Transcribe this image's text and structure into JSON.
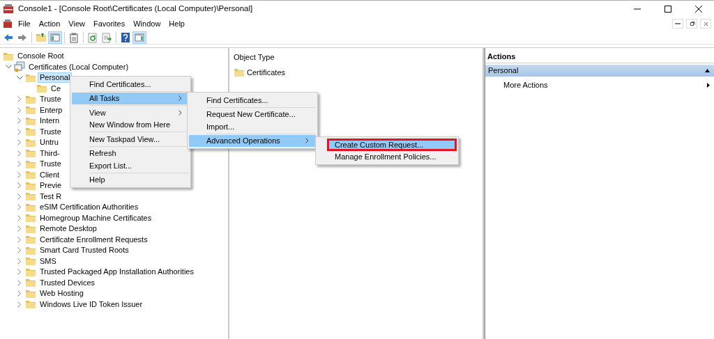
{
  "window": {
    "title": "Console1 - [Console Root\\Certificates (Local Computer)\\Personal]"
  },
  "menu_bar": [
    "File",
    "Action",
    "View",
    "Favorites",
    "Window",
    "Help"
  ],
  "toolbar": [
    {
      "kind": "back",
      "on": false
    },
    {
      "kind": "forward",
      "on": false
    },
    {
      "kind": "sep"
    },
    {
      "kind": "folder-up",
      "on": false
    },
    {
      "kind": "tree-pane",
      "on": true
    },
    {
      "kind": "sep"
    },
    {
      "kind": "clipboard",
      "on": false
    },
    {
      "kind": "sep"
    },
    {
      "kind": "refresh",
      "on": false
    },
    {
      "kind": "export",
      "on": false
    },
    {
      "kind": "sep"
    },
    {
      "kind": "help",
      "on": false
    },
    {
      "kind": "action-pane",
      "on": true
    }
  ],
  "tree": [
    {
      "label": "Console Root",
      "kind": "folder",
      "selected": false,
      "children": [
        {
          "label": "Certificates (Local Computer)",
          "kind": "store",
          "expanded": true,
          "selected": false,
          "children": [
            {
              "label": "Personal",
              "kind": "folder",
              "expanded": true,
              "selected": true,
              "children": [
                {
                  "label": "Ce",
                  "kind": "folder",
                  "selected": false
                }
              ]
            },
            {
              "label": "Truste",
              "kind": "folder",
              "expanded": false,
              "selected": false
            },
            {
              "label": "Enterp",
              "kind": "folder",
              "expanded": false,
              "selected": false
            },
            {
              "label": "Intern",
              "kind": "folder",
              "expanded": false,
              "selected": false
            },
            {
              "label": "Truste",
              "kind": "folder",
              "expanded": false,
              "selected": false
            },
            {
              "label": "Untru",
              "kind": "folder",
              "expanded": false,
              "selected": false
            },
            {
              "label": "Third-",
              "kind": "folder",
              "expanded": false,
              "selected": false
            },
            {
              "label": "Truste",
              "kind": "folder",
              "expanded": false,
              "selected": false
            },
            {
              "label": "Client",
              "kind": "folder",
              "expanded": false,
              "selected": false
            },
            {
              "label": "Previe",
              "kind": "folder",
              "expanded": false,
              "selected": false
            },
            {
              "label": "Test R",
              "kind": "folder",
              "expanded": false,
              "selected": false
            },
            {
              "label": "eSIM Certification Authorities",
              "kind": "folder",
              "expanded": false,
              "selected": false
            },
            {
              "label": "Homegroup Machine Certificates",
              "kind": "folder",
              "expanded": false,
              "selected": false
            },
            {
              "label": "Remote Desktop",
              "kind": "folder",
              "expanded": false,
              "selected": false
            },
            {
              "label": "Certificate Enrollment Requests",
              "kind": "folder",
              "expanded": false,
              "selected": false
            },
            {
              "label": "Smart Card Trusted Roots",
              "kind": "folder",
              "expanded": false,
              "selected": false
            },
            {
              "label": "SMS",
              "kind": "folder",
              "expanded": false,
              "selected": false
            },
            {
              "label": "Trusted Packaged App Installation Authorities",
              "kind": "folder",
              "expanded": false,
              "selected": false
            },
            {
              "label": "Trusted Devices",
              "kind": "folder",
              "expanded": false,
              "selected": false
            },
            {
              "label": "Web Hosting",
              "kind": "folder",
              "expanded": false,
              "selected": false
            },
            {
              "label": "Windows Live ID Token Issuer",
              "kind": "folder",
              "expanded": false,
              "selected": false
            }
          ]
        }
      ]
    }
  ],
  "list": {
    "columns": [
      "Object Type"
    ],
    "rows": [
      "Certificates"
    ]
  },
  "actions": {
    "title": "Actions",
    "section": "Personal",
    "items": [
      "More Actions"
    ]
  },
  "context_menus": [
    {
      "items": [
        {
          "kind": "item",
          "label": "Find Certificates...",
          "submenu": false,
          "selected": false
        },
        {
          "kind": "separator"
        },
        {
          "kind": "item",
          "label": "All Tasks",
          "submenu": true,
          "selected": true
        },
        {
          "kind": "separator"
        },
        {
          "kind": "item",
          "label": "View",
          "submenu": true,
          "selected": false
        },
        {
          "kind": "item",
          "label": "New Window from Here",
          "submenu": false,
          "selected": false
        },
        {
          "kind": "separator"
        },
        {
          "kind": "item",
          "label": "New Taskpad View...",
          "submenu": false,
          "selected": false
        },
        {
          "kind": "separator"
        },
        {
          "kind": "item",
          "label": "Refresh",
          "submenu": false,
          "selected": false
        },
        {
          "kind": "item",
          "label": "Export List...",
          "submenu": false,
          "selected": false
        },
        {
          "kind": "separator"
        },
        {
          "kind": "item",
          "label": "Help",
          "submenu": false,
          "selected": false
        }
      ]
    },
    {
      "items": [
        {
          "kind": "item",
          "label": "Find Certificates...",
          "submenu": false,
          "selected": false
        },
        {
          "kind": "separator"
        },
        {
          "kind": "item",
          "label": "Request New Certificate...",
          "submenu": false,
          "selected": false
        },
        {
          "kind": "item",
          "label": "Import...",
          "submenu": false,
          "selected": false
        },
        {
          "kind": "separator"
        },
        {
          "kind": "item",
          "label": "Advanced Operations",
          "submenu": true,
          "selected": true
        }
      ]
    },
    {
      "items": [
        {
          "kind": "item",
          "label": "Create Custom Request...",
          "submenu": false,
          "selected": true,
          "outlined": true
        },
        {
          "kind": "item",
          "label": "Manage Enrollment Policies...",
          "submenu": false,
          "selected": false
        }
      ]
    }
  ]
}
